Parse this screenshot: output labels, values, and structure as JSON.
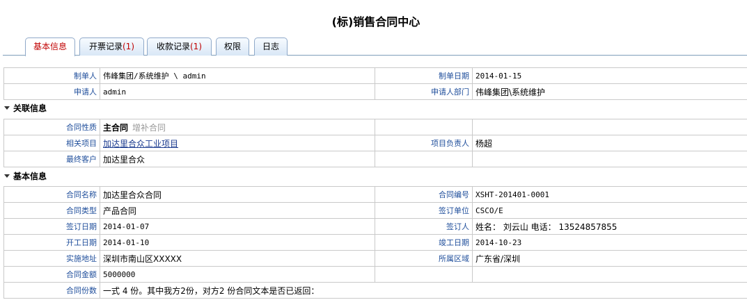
{
  "page": {
    "title": "(标)销售合同中心"
  },
  "tabs": [
    {
      "label": "基本信息",
      "count": ""
    },
    {
      "label": "开票记录",
      "count": "(1)"
    },
    {
      "label": "收款记录",
      "count": "(1)"
    },
    {
      "label": "权限",
      "count": ""
    },
    {
      "label": "日志",
      "count": ""
    }
  ],
  "header_info": {
    "maker_label": "制单人",
    "maker_value": "伟峰集团/系统维护 \\ admin",
    "make_date_label": "制单日期",
    "make_date_value": "2014-01-15",
    "applicant_label": "申请人",
    "applicant_value": "admin",
    "applicant_dept_label": "申请人部门",
    "applicant_dept_value": "伟峰集团\\系统维护"
  },
  "related": {
    "section_title": "关联信息",
    "nature_label": "合同性质",
    "nature_main": "主合同",
    "nature_supp": "增补合同",
    "project_label": "相关项目",
    "project_value": "加达里合众工业项目",
    "project_owner_label": "项目负责人",
    "project_owner_value": "杨超",
    "customer_label": "最终客户",
    "customer_value": "加达里合众"
  },
  "basic": {
    "section_title": "基本信息",
    "name_label": "合同名称",
    "name_value": "加达里合众合同",
    "code_label": "合同编号",
    "code_value": "XSHT-201401-0001",
    "type_label": "合同类型",
    "type_value": "产品合同",
    "sign_unit_label": "签订单位",
    "sign_unit_value": "CSCO/E",
    "sign_date_label": "签订日期",
    "sign_date_value": "2014-01-07",
    "signer_label": "签订人",
    "signer_value": "姓名： 刘云山 电话： 13524857855",
    "start_label": "开工日期",
    "start_value": "2014-01-10",
    "end_label": "竣工日期",
    "end_value": "2014-10-23",
    "address_label": "实施地址",
    "address_value": "深圳市南山区XXXXX",
    "region_label": "所属区域",
    "region_value": "广东省/深圳",
    "amount_label": "合同金额",
    "amount_value": "5000000",
    "copies_label": "合同份数",
    "copies_value": "一式 4 份。其中我方2份，对方2 份合同文本是否已返回："
  }
}
